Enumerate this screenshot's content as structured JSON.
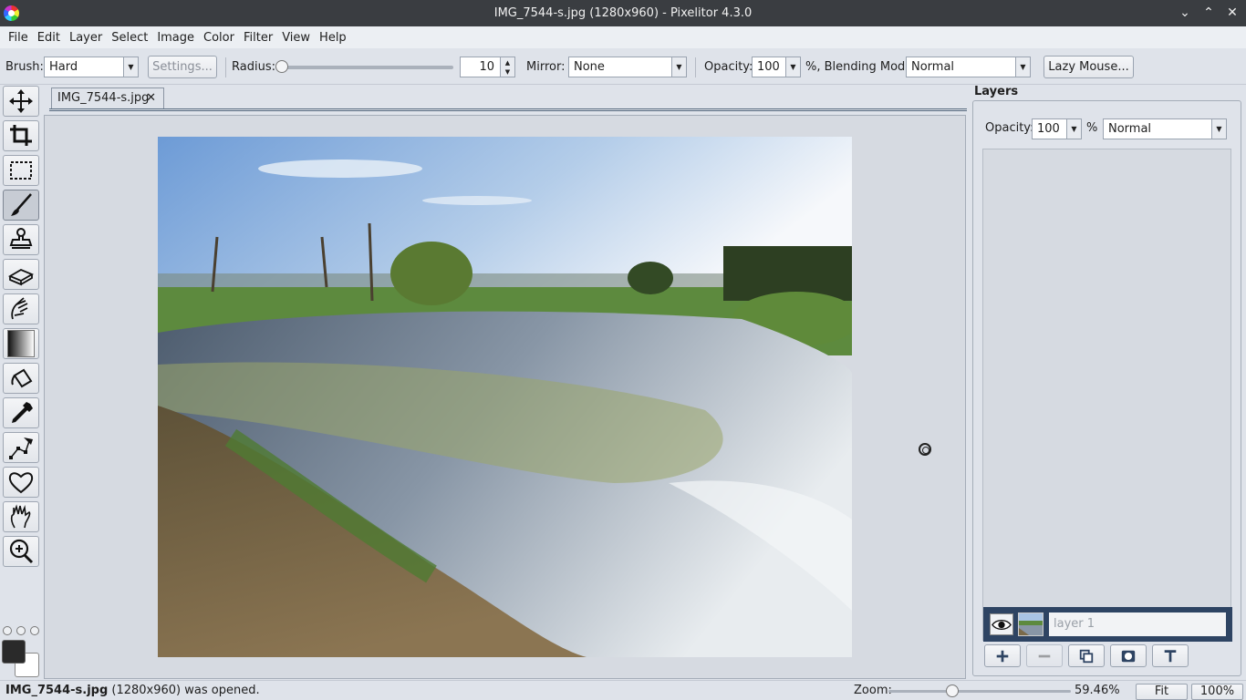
{
  "window": {
    "title": "IMG_7544-s.jpg (1280x960) - Pixelitor 4.3.0"
  },
  "menu": [
    "File",
    "Edit",
    "Layer",
    "Select",
    "Image",
    "Color",
    "Filter",
    "View",
    "Help"
  ],
  "toolbar": {
    "brush_label": "Brush:",
    "brush_value": "Hard",
    "settings_label": "Settings...",
    "radius_label": "Radius:",
    "radius_value": "10",
    "radius_slider_fraction": 0.0,
    "mirror_label": "Mirror:",
    "mirror_value": "None",
    "opacity_label": "Opacity:",
    "opacity_value": "100",
    "blend_label": "%, Blending Mode:",
    "blend_value": "Normal",
    "lazy_mouse_label": "Lazy Mouse..."
  },
  "tools": [
    "move",
    "crop",
    "selection",
    "brush",
    "clone-stamp",
    "eraser",
    "smudge",
    "gradient",
    "paint-bucket",
    "color-picker",
    "pen",
    "shapes",
    "hand",
    "zoom"
  ],
  "active_tool": "brush",
  "colors": {
    "foreground": "#2a2a2a",
    "background": "#ffffff",
    "accent": "#2e4463"
  },
  "document": {
    "tab_label": "IMG_7544-s.jpg",
    "tab_close": "✕"
  },
  "layers_panel": {
    "title": "Layers",
    "opacity_label": "Opacity:",
    "opacity_value": "100",
    "percent": "%",
    "blend_value": "Normal",
    "layers": [
      {
        "name": "layer 1",
        "visible": true
      }
    ],
    "buttons": [
      "add-layer",
      "delete-layer",
      "duplicate-layer",
      "add-mask",
      "add-text-layer"
    ]
  },
  "status": {
    "message_file": "IMG_7544-s.jpg",
    "message_rest": " (1280x960) was opened.",
    "zoom_label": "Zoom:",
    "zoom_value": "59.46%",
    "zoom_fraction": 0.34,
    "fit_label": "Fit",
    "hundred_label": "100%"
  }
}
